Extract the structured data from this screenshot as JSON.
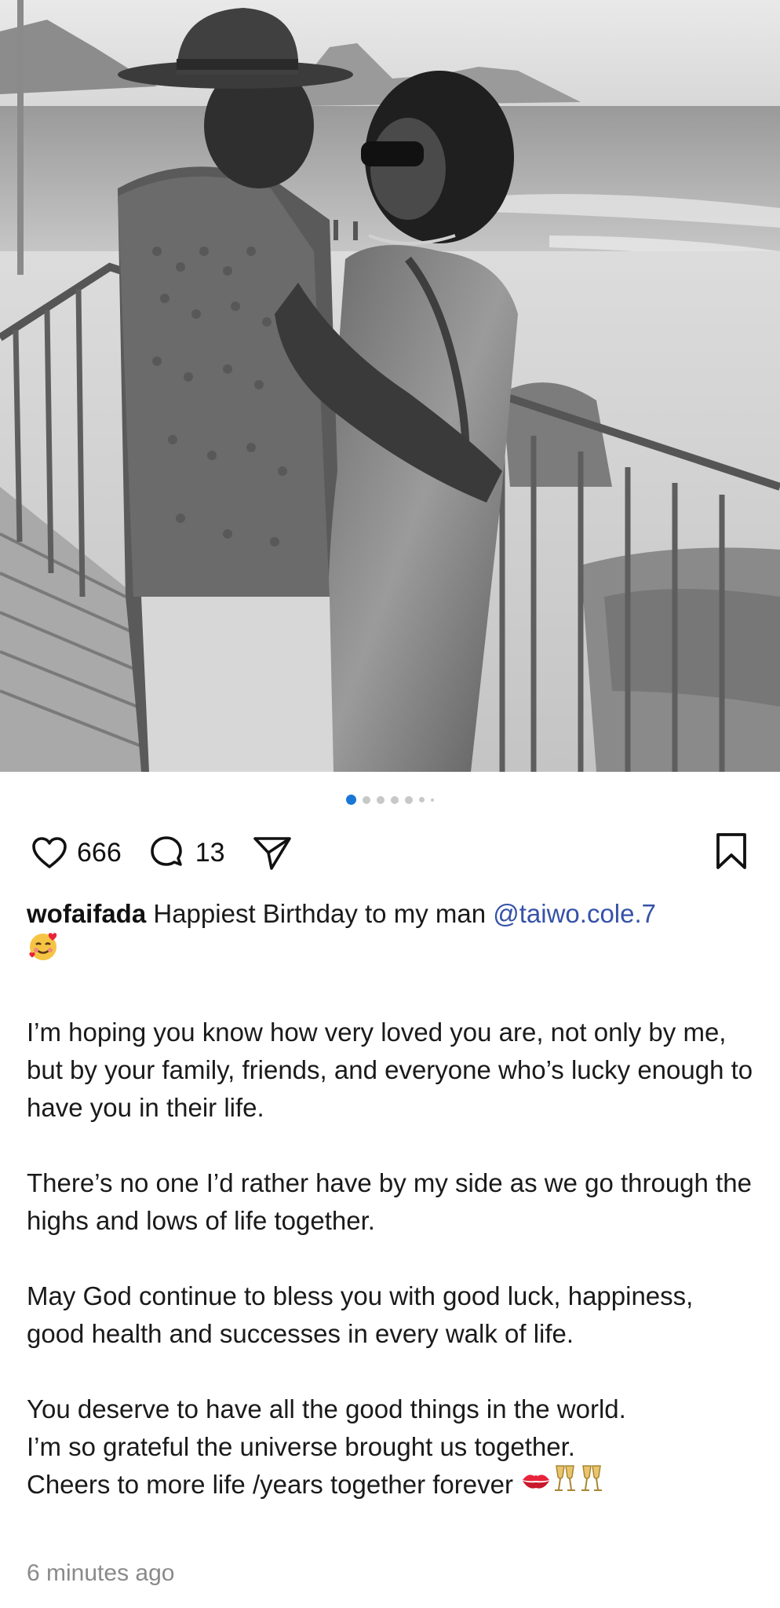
{
  "post": {
    "image_alt": "Black and white photo of a couple embracing by a railing at the beach",
    "carousel_count": 7,
    "carousel_active_index": 0
  },
  "actions": {
    "likes": "666",
    "comments": "13"
  },
  "caption": {
    "username": "wofaifada",
    "line1_text": " Happiest Birthday to my man ",
    "mention": "@taiwo.cole.7",
    "paragraph1": "I’m hoping you know how very loved you are, not only by me, but by your family, friends, and everyone who’s lucky enough to have you in their life.",
    "paragraph2": "There’s no one I’d rather have by my side as we go through the highs and lows of life together.",
    "paragraph3": "May God continue to bless you with good luck, happiness, good health and successes in every walk of life.",
    "paragraph4_line1": "You deserve to have all the good things in the world.",
    "paragraph4_line2": "I’m so grateful the universe brought us together.",
    "paragraph4_line3": "Cheers to more life /years together forever "
  },
  "timestamp": "6 minutes ago",
  "colors": {
    "mention": "#3652a8",
    "active_dot": "#1877d6",
    "timestamp": "#8a8a8a"
  },
  "icons": [
    "heart-icon",
    "comment-icon",
    "share-icon",
    "bookmark-icon",
    "smiling-face-hearts-emoji",
    "kiss-mark-emoji",
    "champagne-glasses-emoji"
  ]
}
